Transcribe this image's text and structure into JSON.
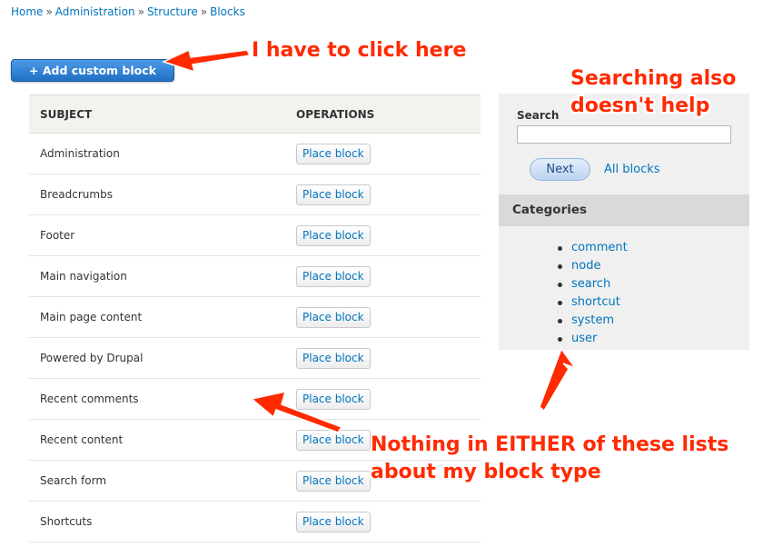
{
  "breadcrumb": {
    "items": [
      "Home",
      "Administration",
      "Structure",
      "Blocks"
    ],
    "separator": "»"
  },
  "add_button": {
    "label": "+ Add custom block"
  },
  "table": {
    "headers": {
      "subject": "SUBJECT",
      "operations": "OPERATIONS"
    },
    "rows": [
      {
        "subject": "Administration",
        "action": "Place block"
      },
      {
        "subject": "Breadcrumbs",
        "action": "Place block"
      },
      {
        "subject": "Footer",
        "action": "Place block"
      },
      {
        "subject": "Main navigation",
        "action": "Place block"
      },
      {
        "subject": "Main page content",
        "action": "Place block"
      },
      {
        "subject": "Powered by Drupal",
        "action": "Place block"
      },
      {
        "subject": "Recent comments",
        "action": "Place block"
      },
      {
        "subject": "Recent content",
        "action": "Place block"
      },
      {
        "subject": "Search form",
        "action": "Place block"
      },
      {
        "subject": "Shortcuts",
        "action": "Place block"
      }
    ]
  },
  "sidebar": {
    "search_label": "Search",
    "search_value": "",
    "next_label": "Next",
    "all_blocks_label": "All blocks",
    "categories_title": "Categories",
    "categories": [
      "comment",
      "node",
      "search",
      "shortcut",
      "system",
      "user"
    ]
  },
  "annotations": {
    "click_here": "I have to click here",
    "searching": [
      "Searching also",
      "doesn't help"
    ],
    "nothing": [
      "Nothing in EITHER of these lists",
      "about my block type"
    ]
  },
  "colors": {
    "link": "#0074bd",
    "annotation": "#ff2a00",
    "button": "#1f6fc5"
  }
}
